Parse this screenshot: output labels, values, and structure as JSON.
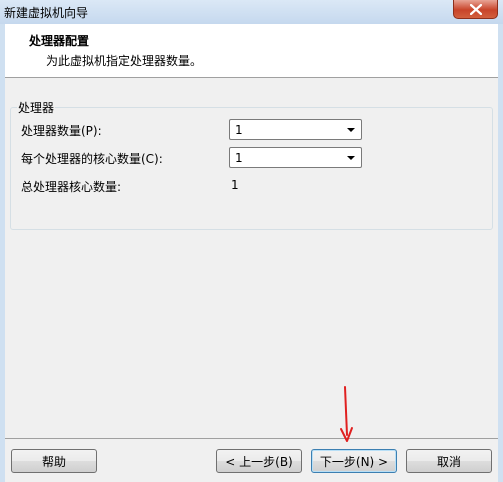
{
  "window": {
    "title": "新建虚拟机向导"
  },
  "header": {
    "title": "处理器配置",
    "subtitle": "为此虚拟机指定处理器数量。"
  },
  "processors_group": {
    "title": "处理器",
    "processor_count": {
      "label": "处理器数量(P):",
      "value": "1"
    },
    "cores_per_processor": {
      "label": "每个处理器的核心数量(C):",
      "value": "1"
    },
    "total_cores": {
      "label": "总处理器核心数量:",
      "value": "1"
    }
  },
  "buttons": {
    "help": "帮助",
    "back": "< 上一步(B)",
    "next": "下一步(N) >",
    "cancel": "取消"
  },
  "colors": {
    "annotation_arrow": "#e02020",
    "close_button": "#c8442a"
  }
}
